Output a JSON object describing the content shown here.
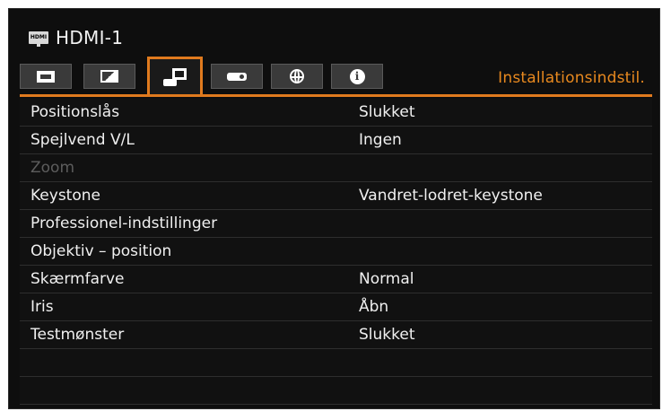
{
  "source": {
    "icon": "hdmi-icon",
    "icon_text": "HDMI",
    "label": "HDMI-1"
  },
  "tabs": [
    {
      "icon": "screen-icon",
      "active": false
    },
    {
      "icon": "image-adjust-icon",
      "active": false
    },
    {
      "icon": "installation-icon",
      "active": true
    },
    {
      "icon": "projector-icon",
      "active": false
    },
    {
      "icon": "globe-icon",
      "active": false
    },
    {
      "icon": "info-icon",
      "active": false
    }
  ],
  "tab_title": "Installationsindstil.",
  "colors": {
    "accent": "#e07a1e",
    "title": "#e8891f",
    "background": "#0e0e0e",
    "disabled": "#5d5d5d"
  },
  "menu": [
    {
      "label": "Positionslås",
      "value": "Slukket",
      "enabled": true
    },
    {
      "label": "Spejlvend V/L",
      "value": "Ingen",
      "enabled": true
    },
    {
      "label": "Zoom",
      "value": "",
      "enabled": false
    },
    {
      "label": "Keystone",
      "value": "Vandret-lodret-keystone",
      "enabled": true
    },
    {
      "label": "Professionel-indstillinger",
      "value": "",
      "enabled": true
    },
    {
      "label": "Objektiv – position",
      "value": "",
      "enabled": true
    },
    {
      "label": "Skærmfarve",
      "value": "Normal",
      "enabled": true
    },
    {
      "label": "Iris",
      "value": "Åbn",
      "enabled": true
    },
    {
      "label": "Testmønster",
      "value": "Slukket",
      "enabled": true
    },
    {
      "label": "",
      "value": "",
      "enabled": true
    },
    {
      "label": "",
      "value": "",
      "enabled": true
    }
  ]
}
